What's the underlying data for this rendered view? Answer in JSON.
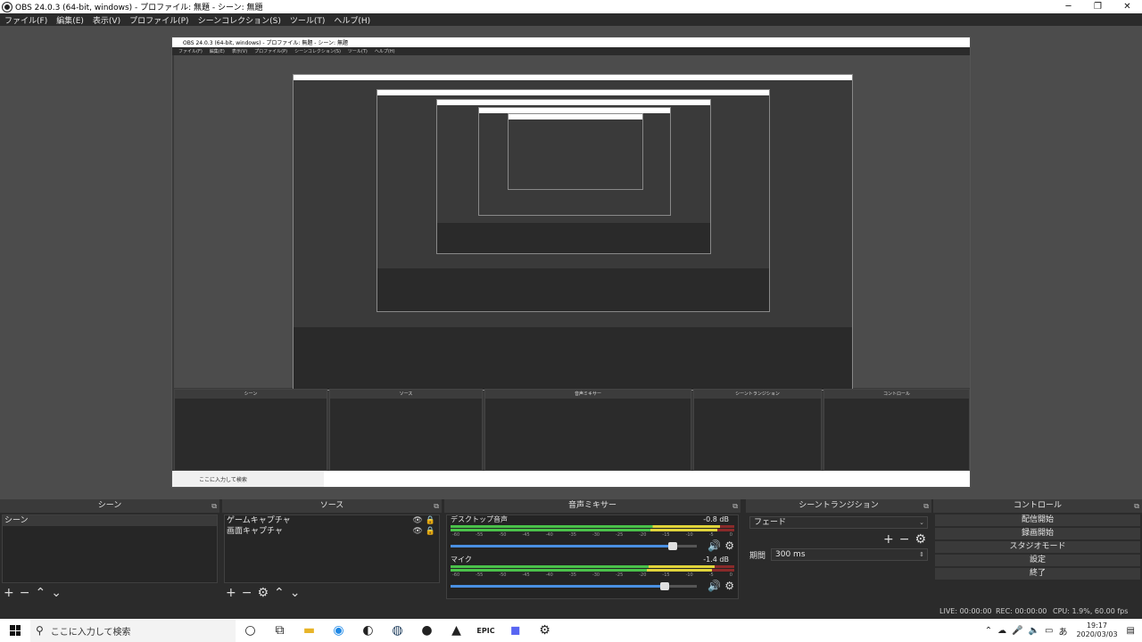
{
  "window": {
    "title": "OBS 24.0.3 (64-bit, windows) - プロファイル: 無題 - シーン: 無題",
    "minimize": "─",
    "maximize": "❐",
    "close": "✕"
  },
  "menu": [
    "ファイル(F)",
    "編集(E)",
    "表示(V)",
    "プロファイル(P)",
    "シーンコレクション(S)",
    "ツール(T)",
    "ヘルプ(H)"
  ],
  "captured": {
    "title": "OBS 24.0.3 (64-bit, windows) - プロファイル: 無題 - シーン: 無題",
    "menu": [
      "ファイル(F)",
      "編集(E)",
      "表示(V)",
      "プロファイル(P)",
      "シーンコレクション(S)",
      "ツール(T)",
      "ヘルプ(H)"
    ],
    "docks": [
      "シーン",
      "ソース",
      "音声ミキサー",
      "シーントランジション",
      "コントロール"
    ],
    "search": "ここに入力して検索"
  },
  "docks": {
    "scenes": {
      "title": "シーン",
      "items": [
        "シーン"
      ]
    },
    "sources": {
      "title": "ソース",
      "items": [
        "ゲームキャプチャ",
        "画面キャプチャ"
      ]
    },
    "mixer": {
      "title": "音声ミキサー",
      "tracks": [
        {
          "name": "デスクトップ音声",
          "db": "-0.8 dB",
          "level": 0.95,
          "volume": 0.9
        },
        {
          "name": "マイク",
          "db": "-1.4 dB",
          "level": 0.93,
          "volume": 0.87
        }
      ],
      "ticks": [
        "-60",
        "-55",
        "-50",
        "-45",
        "-40",
        "-35",
        "-30",
        "-25",
        "-20",
        "-15",
        "-10",
        "-5",
        "0"
      ]
    },
    "transitions": {
      "title": "シーントランジション",
      "type": "フェード",
      "duration_label": "期間",
      "duration": "300 ms"
    },
    "controls": {
      "title": "コントロール",
      "buttons": [
        "配信開始",
        "録画開始",
        "スタジオモード",
        "設定",
        "終了"
      ]
    }
  },
  "status": {
    "live": "LIVE: 00:00:00",
    "rec": "REC: 00:00:00",
    "cpu": "CPU: 1.9%, 60.00 fps"
  },
  "taskbar": {
    "search_placeholder": "ここに入力して検索",
    "time": "19:17",
    "date": "2020/03/03"
  }
}
